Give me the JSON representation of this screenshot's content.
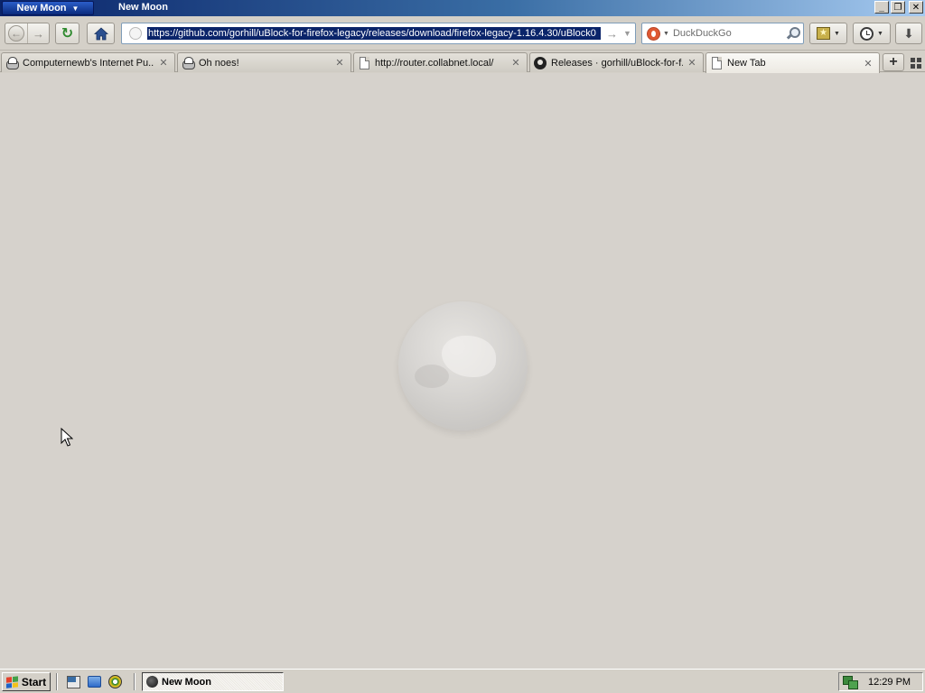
{
  "window": {
    "app_menu_label": "New Moon",
    "title": "New Moon",
    "controls": {
      "minimize": "_",
      "maximize": "❐",
      "close": "✕"
    }
  },
  "toolbar": {
    "back_icon": "←",
    "forward_icon": "→",
    "reload_icon": "↻",
    "url": "https://github.com/gorhill/uBlock-for-firefox-legacy/releases/download/firefox-legacy-1.16.4.30/uBlock0",
    "go_icon": "→",
    "url_dropdown_icon": "▼",
    "search_engine": "DuckDuckGo",
    "download_icon": "⬇"
  },
  "tabs": [
    {
      "label": "Computernewb's Internet Pu...",
      "icon": "nerd-icon",
      "close": "✕"
    },
    {
      "label": "Oh noes!",
      "icon": "nerd-icon",
      "close": "✕"
    },
    {
      "label": "http://router.collabnet.local/",
      "icon": "page-icon",
      "close": "✕"
    },
    {
      "label": "Releases · gorhill/uBlock-for-f...",
      "icon": "github-icon",
      "close": "✕"
    },
    {
      "label": "New Tab",
      "icon": "page-icon",
      "close": "✕",
      "active": true
    }
  ],
  "tabstrip": {
    "new_tab_icon": "+"
  },
  "taskbar": {
    "start_label": "Start",
    "task_label": "New Moon",
    "clock": "12:29 PM"
  },
  "colors": {
    "titlebar_start": "#0a246a",
    "titlebar_end": "#a6caf0",
    "url_selection": "#0a246a",
    "content_bg": "#d6d2cc",
    "reload_green": "#2f8a2f",
    "ddg_orange": "#de5833"
  }
}
